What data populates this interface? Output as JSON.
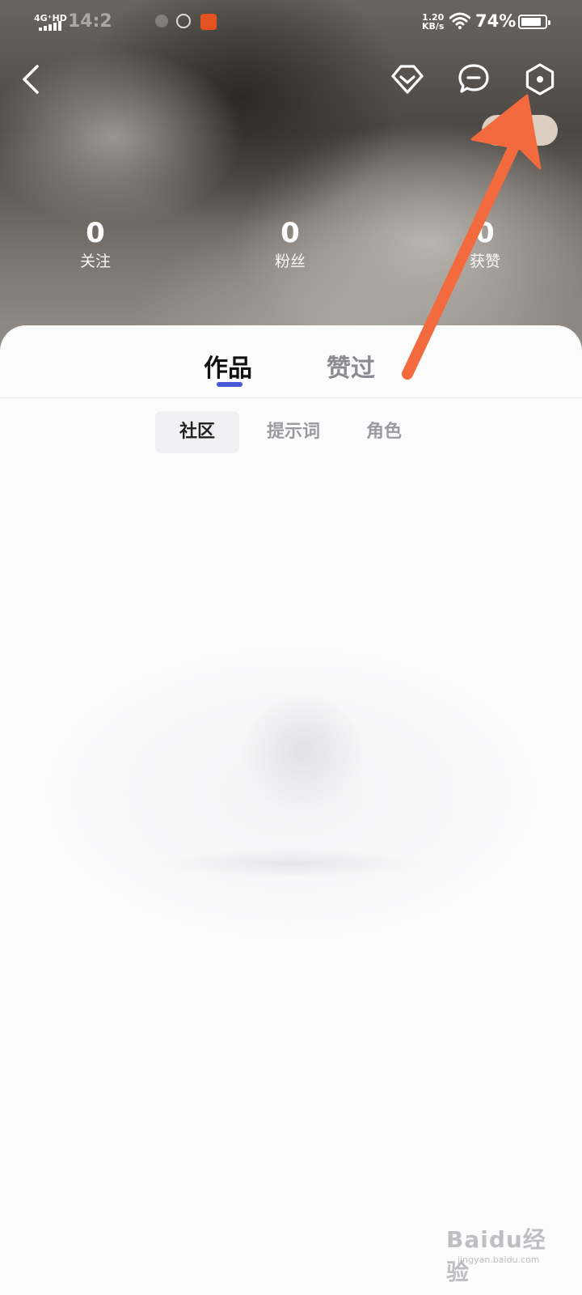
{
  "status_bar": {
    "network": "4G⁺HD",
    "time": "14:2",
    "speed_value": "1.20",
    "speed_unit": "KB/s",
    "battery": "74%"
  },
  "header": {
    "back_icon": "chevron-left-icon",
    "vip_icon": "diamond-icon",
    "message_icon": "message-icon",
    "settings_icon": "settings-gear-icon",
    "coin_icon": "coin-icon"
  },
  "stats": [
    {
      "value": "0",
      "label": "关注"
    },
    {
      "value": "0",
      "label": "粉丝"
    },
    {
      "value": "0",
      "label": "获赞"
    }
  ],
  "tabs": [
    {
      "label": "作品",
      "active": true
    },
    {
      "label": "赞过",
      "active": false
    }
  ],
  "sub_tabs": [
    {
      "label": "社区",
      "active": true
    },
    {
      "label": "提示词",
      "active": false
    },
    {
      "label": "角色",
      "active": false
    }
  ],
  "annotation": {
    "color": "#f26a3d"
  },
  "watermark": {
    "text": "Baidu经验",
    "url": "jingyan.baidu.com"
  },
  "colors": {
    "accent": "#4a57d6",
    "annotation_arrow": "#f26a3d"
  }
}
